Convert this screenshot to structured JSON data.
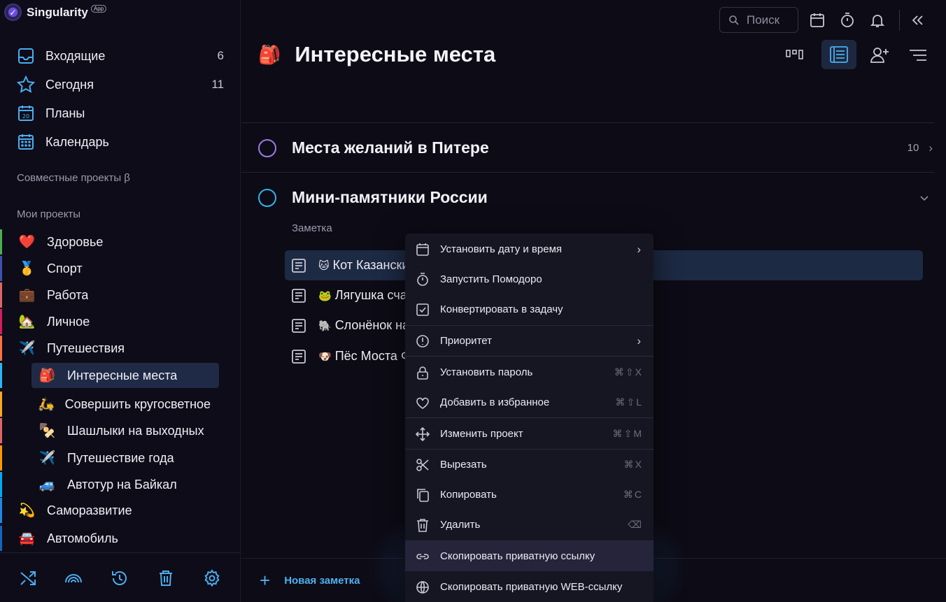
{
  "app": {
    "name": "Singularity",
    "badge": "App"
  },
  "sidebar": {
    "nav": [
      {
        "label": "Входящие",
        "count": "6",
        "icon": "inbox-icon"
      },
      {
        "label": "Сегодня",
        "count": "11",
        "icon": "star-icon"
      },
      {
        "label": "Планы",
        "count": "",
        "icon": "calendar-20-icon"
      },
      {
        "label": "Календарь",
        "count": "",
        "icon": "calendar-grid-icon"
      }
    ],
    "shared_title": "Совместные проекты β",
    "my_title": "Мои проекты",
    "projects": [
      {
        "emoji": "❤️",
        "label": "Здоровье",
        "color": "#4caf50"
      },
      {
        "emoji": "🥇",
        "label": "Спорт",
        "color": "#3f51b5"
      },
      {
        "emoji": "💼",
        "label": "Работа",
        "color": "#e06666"
      },
      {
        "emoji": "🏡",
        "label": "Личное",
        "color": "#d81b60"
      },
      {
        "emoji": "✈️",
        "label": "Путешествия",
        "color": "#ff7043"
      }
    ],
    "subprojects": [
      {
        "emoji": "🎒",
        "label": "Интересные места",
        "color": "#29b6f6"
      },
      {
        "emoji": "🛵",
        "label": "Совершить кругосветное путешествие",
        "color": "#f9a825"
      },
      {
        "emoji": "🍢",
        "label": "Шашлыки на выходных",
        "color": "#e06666"
      },
      {
        "emoji": "✈️",
        "label": "Путешествие года",
        "color": "#ff9800"
      },
      {
        "emoji": "🚙",
        "label": "Автотур на Байкал",
        "color": "#03a9f4"
      }
    ],
    "projects2": [
      {
        "emoji": "💫",
        "label": "Саморазвитие",
        "color": "#1e88e5"
      },
      {
        "emoji": "🚘",
        "label": "Автомобиль",
        "color": "#1565c0"
      }
    ]
  },
  "header": {
    "search_placeholder": "Поиск",
    "title_emoji": "🎒",
    "title": "Интересные места"
  },
  "rows": [
    {
      "title": "Места желаний в Питере",
      "count": "10",
      "circle_color": "#9b7be8"
    },
    {
      "title": "Мини-памятники России",
      "count": "",
      "circle_color": "#2db6e8"
    }
  ],
  "notes_label": "Заметка",
  "notes": [
    {
      "emoji": "🐱",
      "text": "Кот Казанский"
    },
    {
      "emoji": "🐸",
      "text": "Лягушка счастья"
    },
    {
      "emoji": "🐘",
      "text": "Слонёнок на"
    },
    {
      "emoji": "🐶",
      "text": "Пёс Моста Ф"
    }
  ],
  "new_note": "Новая заметка",
  "context_menu": [
    {
      "label": "Установить дату и время",
      "shortcut": "",
      "submenu": "›",
      "icon": "calendar-icon"
    },
    {
      "label": "Запустить Помодоро",
      "shortcut": "",
      "submenu": "",
      "icon": "timer-icon"
    },
    {
      "label": "Конвертировать в задачу",
      "shortcut": "",
      "submenu": "",
      "icon": "checkbox-icon"
    },
    {
      "label": "Приоритет",
      "shortcut": "",
      "submenu": "›",
      "icon": "priority-icon"
    },
    {
      "label": "Установить пароль",
      "shortcut": "⌘⇧X",
      "submenu": "",
      "icon": "lock-icon"
    },
    {
      "label": "Добавить в избранное",
      "shortcut": "⌘⇧L",
      "submenu": "",
      "icon": "heart-icon"
    },
    {
      "label": "Изменить проект",
      "shortcut": "⌘⇧M",
      "submenu": "",
      "icon": "move-icon"
    },
    {
      "label": "Вырезать",
      "shortcut": "⌘X",
      "submenu": "",
      "icon": "scissors-icon"
    },
    {
      "label": "Копировать",
      "shortcut": "⌘C",
      "submenu": "",
      "icon": "copy-icon"
    },
    {
      "label": "Удалить",
      "shortcut": "⌫",
      "submenu": "",
      "icon": "trash-icon"
    },
    {
      "label": "Скопировать приватную ссылку",
      "shortcut": "",
      "submenu": "",
      "icon": "link-icon"
    },
    {
      "label": "Скопировать приватную WEB-ссылку",
      "shortcut": "",
      "submenu": "",
      "icon": "web-link-icon"
    }
  ]
}
